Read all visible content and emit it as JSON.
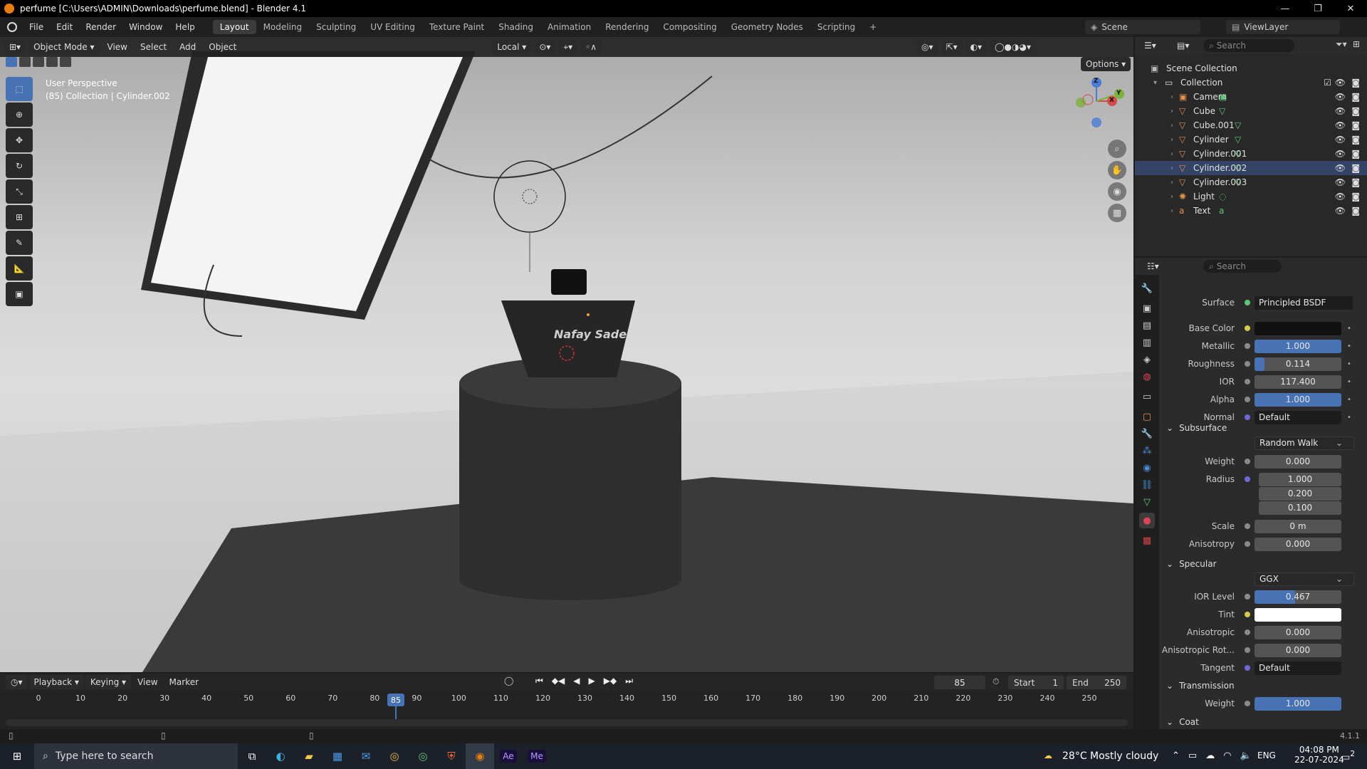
{
  "window": {
    "title": "perfume [C:\\Users\\ADMIN\\Downloads\\perfume.blend] - Blender 4.1",
    "controls": [
      "—",
      "❐",
      "✕"
    ]
  },
  "menu": {
    "items": [
      "File",
      "Edit",
      "Render",
      "Window",
      "Help"
    ]
  },
  "workspaces": [
    "Layout",
    "Modeling",
    "Sculpting",
    "UV Editing",
    "Texture Paint",
    "Shading",
    "Animation",
    "Rendering",
    "Compositing",
    "Geometry Nodes",
    "Scripting",
    "+"
  ],
  "active_workspace": "Layout",
  "scene": {
    "name": "Scene",
    "view_layer": "ViewLayer"
  },
  "viewport": {
    "mode": "Object Mode",
    "menus": [
      "View",
      "Select",
      "Add",
      "Object"
    ],
    "orientation": "Local",
    "options_label": "Options",
    "overlay_line1": "User Perspective",
    "overlay_line2": "(85) Collection | Cylinder.002",
    "bottle_label": "Nafay Sade",
    "gizmo": {
      "x": "X",
      "y": "Y",
      "z": "Z"
    }
  },
  "outliner": {
    "search_placeholder": "Search",
    "root": "Scene Collection",
    "collection": "Collection",
    "items": [
      "Camera",
      "Cube",
      "Cube.001",
      "Cylinder",
      "Cylinder.001",
      "Cylinder.002",
      "Cylinder.003",
      "Light",
      "Text"
    ],
    "icon_colors": {
      "object": "#e8914a",
      "data": "#5fc77a",
      "camera": "#5fc77a"
    }
  },
  "properties": {
    "search_placeholder": "Search",
    "surface": {
      "label": "Surface",
      "value": "Principled BSDF"
    },
    "rows": [
      {
        "label": "Base Color",
        "value": ""
      },
      {
        "label": "Metallic",
        "value": "1.000",
        "fill": 1.0
      },
      {
        "label": "Roughness",
        "value": "0.114",
        "fill": 0.114
      },
      {
        "label": "IOR",
        "value": "117.400"
      },
      {
        "label": "Alpha",
        "value": "1.000",
        "fill": 1.0
      },
      {
        "label": "Normal",
        "value": "Default"
      }
    ],
    "subsurface": {
      "title": "Subsurface",
      "method": "Random Walk",
      "weight": {
        "label": "Weight",
        "value": "0.000"
      },
      "radius": {
        "label": "Radius",
        "values": [
          "1.000",
          "0.200",
          "0.100"
        ]
      },
      "scale": {
        "label": "Scale",
        "value": "0 m"
      },
      "anisotropy": {
        "label": "Anisotropy",
        "value": "0.000"
      }
    },
    "specular": {
      "title": "Specular",
      "distribution": "GGX",
      "ior_level": {
        "label": "IOR Level",
        "value": "0.467",
        "fill": 0.467
      },
      "tint": {
        "label": "Tint",
        "value": ""
      },
      "anisotropic": {
        "label": "Anisotropic",
        "value": "0.000"
      },
      "anisotropic_rot": {
        "label": "Anisotropic Rot...",
        "value": "0.000"
      },
      "tangent": {
        "label": "Tangent",
        "value": "Default"
      }
    },
    "transmission": {
      "title": "Transmission",
      "weight": {
        "label": "Weight",
        "value": "1.000",
        "fill": 1.0
      }
    },
    "coat": {
      "title": "Coat"
    }
  },
  "timeline": {
    "menus": [
      "Playback",
      "Keying",
      "View",
      "Marker"
    ],
    "current_frame": "85",
    "start_label": "Start",
    "start": "1",
    "end_label": "End",
    "end": "250",
    "ticks": [
      "0",
      "10",
      "20",
      "30",
      "40",
      "50",
      "60",
      "70",
      "80",
      "90",
      "100",
      "110",
      "120",
      "130",
      "140",
      "150",
      "160",
      "170",
      "180",
      "190",
      "200",
      "210",
      "220",
      "230",
      "240",
      "250"
    ]
  },
  "statusbar": {
    "version": "4.1.1"
  },
  "taskbar": {
    "search_placeholder": "Type here to search",
    "weather": "28°C  Mostly cloudy",
    "lang": "ENG",
    "time": "04:08 PM",
    "date": "22-07-2024",
    "notifications": "2",
    "apps": [
      "Ae",
      "Me"
    ]
  }
}
